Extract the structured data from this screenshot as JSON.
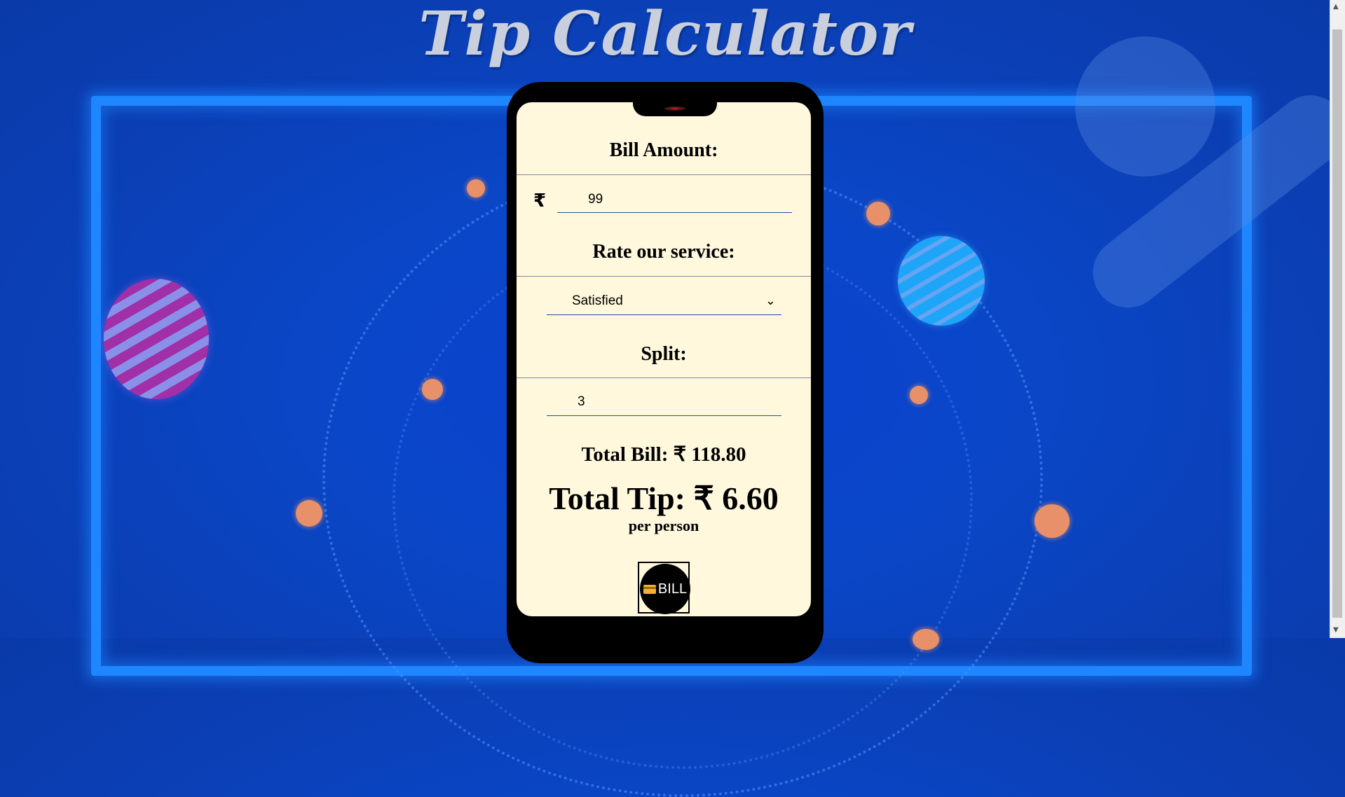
{
  "app": {
    "title": "Tip Calculator"
  },
  "bill": {
    "label": "Bill Amount:",
    "currency_symbol": "₹",
    "value": "99"
  },
  "service": {
    "label": "Rate our service:",
    "selected": "Satisfied"
  },
  "split": {
    "label": "Split:",
    "value": "3"
  },
  "results": {
    "total_bill": "Total Bill: ₹ 118.80",
    "total_tip": "Total Tip: ₹ 6.60",
    "per_person": "per person"
  },
  "bill_button": {
    "label": "BILL",
    "icon": "credit-card-icon"
  },
  "colors": {
    "background": "#0a47c8",
    "screen": "#fff8dd",
    "accent_frame": "#1e86ff",
    "title": "#c9cfdd"
  }
}
